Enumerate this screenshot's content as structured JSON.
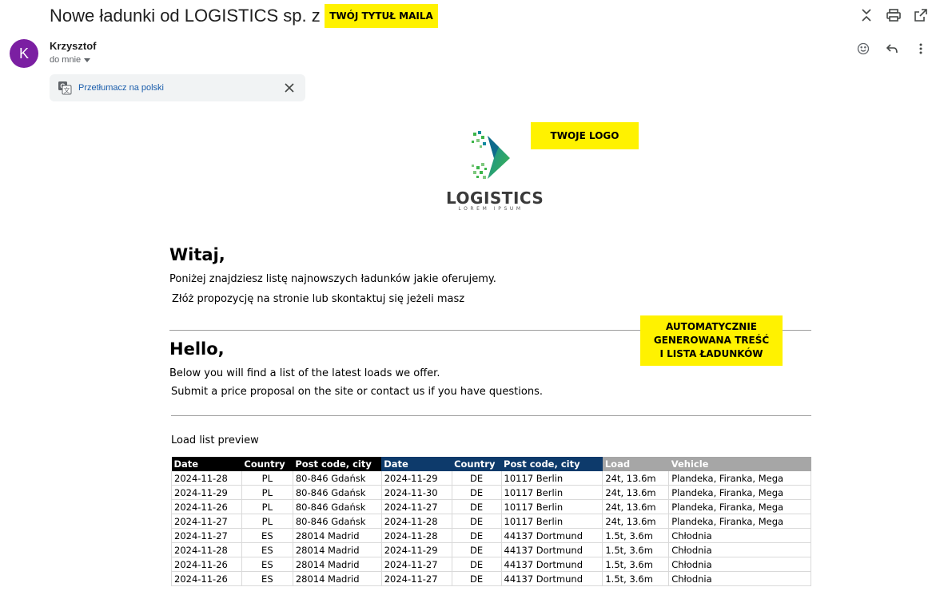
{
  "email": {
    "subject": "Nowe ładunki od LOGISTICS sp. z o.o.",
    "sender_name": "Krzysztof",
    "sender_initial": "K",
    "recipient": "do mnie",
    "translate_label": "Przetłumacz na polski"
  },
  "annotations": {
    "title_note": "TWÓJ TYTUŁ MAILA",
    "logo_note": "TWOJE LOGO",
    "auto_note_1": "AUTOMATYCZNIE",
    "auto_note_2": "GENEROWANA TREŚĆ",
    "auto_note_3": "I LISTA ŁADUNKÓW"
  },
  "logo": {
    "name": "LOGISTICS",
    "tagline": "LOREM IPSUM"
  },
  "body": {
    "pl_greeting": "Witaj,",
    "pl_line1": "Poniżej znajdziesz listę najnowszych ładunków jakie oferujemy.",
    "pl_line2": "Złóż propozycję na stronie lub skontaktuj się jeżeli masz",
    "en_greeting": "Hello,",
    "en_line1": "Below you will find a list of the latest loads we offer.",
    "en_line2": "Submit a price proposal on the site or contact us if you have questions.",
    "preview_title": "Load list preview"
  },
  "table": {
    "headers": [
      "Date",
      "Country",
      "Post code, city",
      "Date",
      "Country",
      "Post code, city",
      "Load",
      "Vehicle"
    ],
    "rows": [
      [
        "2024-11-28",
        "PL",
        "80-846 Gdańsk",
        "2024-11-29",
        "DE",
        "10117 Berlin",
        "24t, 13.6m",
        "Plandeka, Firanka, Mega"
      ],
      [
        "2024-11-29",
        "PL",
        "80-846 Gdańsk",
        "2024-11-30",
        "DE",
        "10117 Berlin",
        "24t, 13.6m",
        "Plandeka, Firanka, Mega"
      ],
      [
        "2024-11-26",
        "PL",
        "80-846 Gdańsk",
        "2024-11-27",
        "DE",
        "10117 Berlin",
        "24t, 13.6m",
        "Plandeka, Firanka, Mega"
      ],
      [
        "2024-11-27",
        "PL",
        "80-846 Gdańsk",
        "2024-11-28",
        "DE",
        "10117 Berlin",
        "24t, 13.6m",
        "Plandeka, Firanka, Mega"
      ],
      [
        "2024-11-27",
        "ES",
        "28014 Madrid",
        "2024-11-28",
        "DE",
        "44137 Dortmund",
        "1.5t, 3.6m",
        "Chłodnia"
      ],
      [
        "2024-11-28",
        "ES",
        "28014 Madrid",
        "2024-11-29",
        "DE",
        "44137 Dortmund",
        "1.5t, 3.6m",
        "Chłodnia"
      ],
      [
        "2024-11-26",
        "ES",
        "28014 Madrid",
        "2024-11-27",
        "DE",
        "44137 Dortmund",
        "1.5t, 3.6m",
        "Chłodnia"
      ],
      [
        "2024-11-26",
        "ES",
        "28014 Madrid",
        "2024-11-27",
        "DE",
        "44137 Dortmund",
        "1.5t, 3.6m",
        "Chłodnia"
      ]
    ]
  },
  "colors": {
    "avatar": "#7b1fa2",
    "note_yellow": "#fff200",
    "header_black": "#000000",
    "header_blue": "#0d3a6b",
    "header_grey": "#a6a6a6",
    "logo_green": "#3db54a",
    "logo_teal": "#138a9e"
  }
}
